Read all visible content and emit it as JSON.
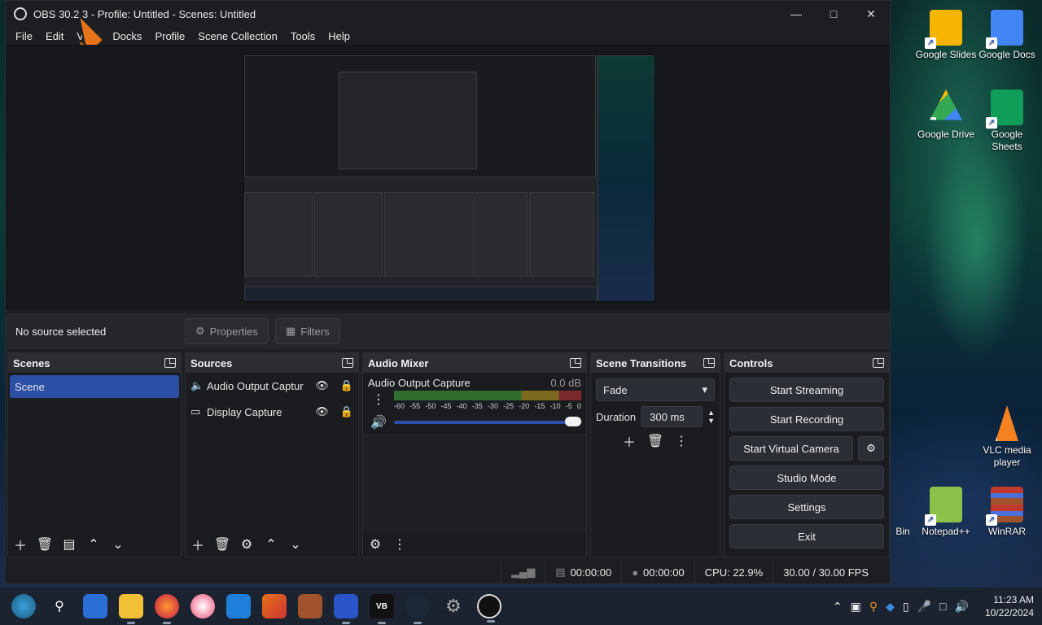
{
  "window": {
    "title": "OBS 30.2.3 - Profile: Untitled - Scenes: Untitled"
  },
  "menu": [
    "File",
    "Edit",
    "View",
    "Docks",
    "Profile",
    "Scene Collection",
    "Tools",
    "Help"
  ],
  "source_toolbar": {
    "status": "No source selected",
    "properties": "Properties",
    "filters": "Filters"
  },
  "scenes": {
    "title": "Scenes",
    "items": [
      "Scene"
    ]
  },
  "sources": {
    "title": "Sources",
    "items": [
      "Audio Output Captur",
      "Display Capture"
    ]
  },
  "audio_mixer": {
    "title": "Audio Mixer",
    "channel_name": "Audio Output Capture",
    "level": "0.0 dB",
    "scale": [
      "-60",
      "-55",
      "-50",
      "-45",
      "-40",
      "-35",
      "-30",
      "-25",
      "-20",
      "-15",
      "-10",
      "-5",
      "0"
    ],
    "volume_fraction": 1.0
  },
  "transitions": {
    "title": "Scene Transitions",
    "selected": "Fade",
    "duration_label": "Duration",
    "duration_value": "300 ms"
  },
  "controls": {
    "title": "Controls",
    "start_streaming": "Start Streaming",
    "start_recording": "Start Recording",
    "start_virtual_camera": "Start Virtual Camera",
    "studio_mode": "Studio Mode",
    "settings": "Settings",
    "exit": "Exit"
  },
  "status": {
    "stream_time": "00:00:00",
    "record_time": "00:00:00",
    "cpu": "CPU: 22.9%",
    "fps": "30.00 / 30.00 FPS"
  },
  "desktop_icons": [
    {
      "label": "Google Slides",
      "color": "#f4b400"
    },
    {
      "label": "Google Docs",
      "color": "#4285f4"
    },
    {
      "label": "Google Drive",
      "color": "#34a853"
    },
    {
      "label": "Google Sheets",
      "color": "#0f9d58"
    },
    {
      "label": "VLC media player",
      "color": "#f58220"
    },
    {
      "label": "Bin",
      "color": "#8aa0b8"
    },
    {
      "label": "Notepad++",
      "color": "#8bc34a"
    },
    {
      "label": "WinRAR",
      "color": "#a0522d"
    }
  ],
  "clock": {
    "time": "11:23 AM",
    "date": "10/22/2024"
  }
}
